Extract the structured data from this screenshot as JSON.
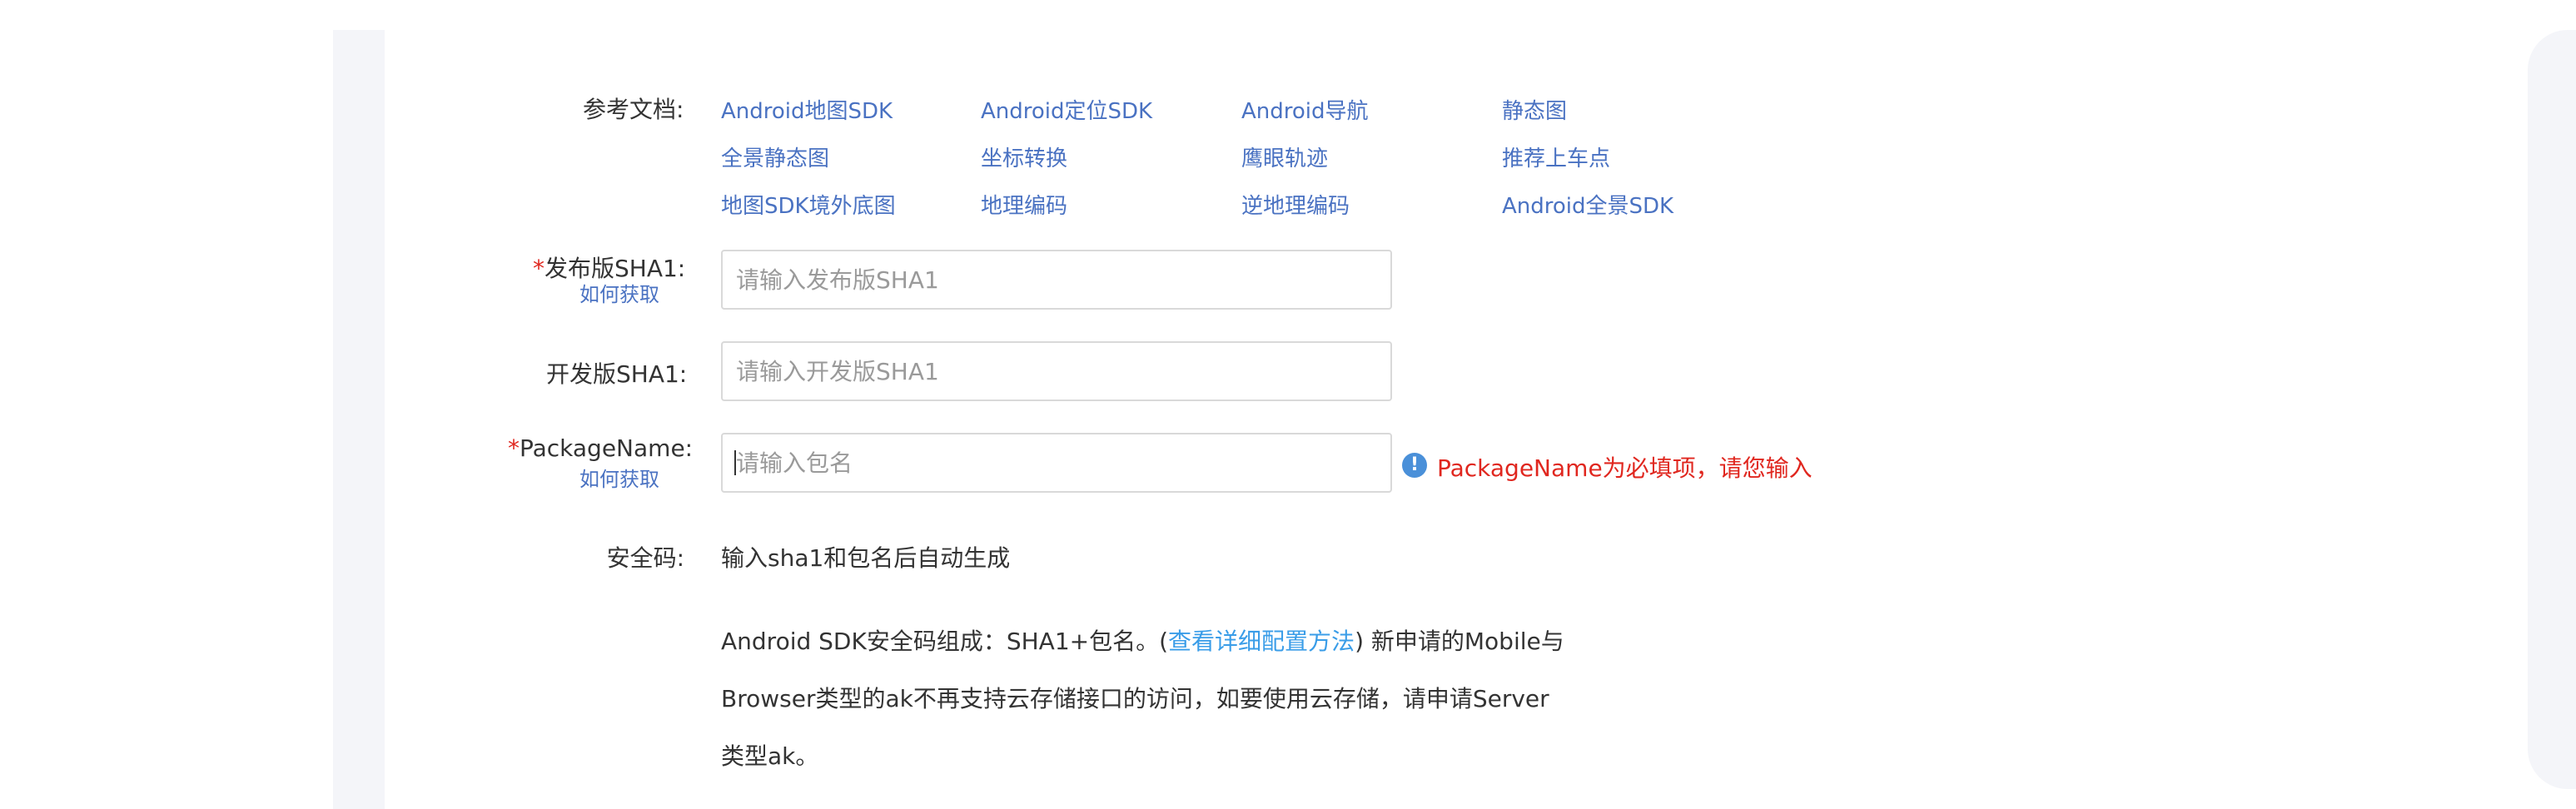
{
  "form": {
    "docs": {
      "label": "参考文档:",
      "links": [
        [
          "Android地图SDK",
          "Android定位SDK",
          "Android导航",
          "静态图"
        ],
        [
          "全景静态图",
          "坐标转换",
          "鹰眼轨迹",
          "推荐上车点"
        ],
        [
          "地图SDK境外底图",
          "地理编码",
          "逆地理编码",
          "Android全景SDK"
        ]
      ]
    },
    "release_sha1": {
      "required_mark": "*",
      "label": "发布版SHA1:",
      "help_link": "如何获取",
      "placeholder": "请输入发布版SHA1"
    },
    "dev_sha1": {
      "label": "开发版SHA1:",
      "placeholder": "请输入开发版SHA1"
    },
    "package_name": {
      "required_mark": "*",
      "label": "PackageName:",
      "help_link": "如何获取",
      "placeholder": "请输入包名",
      "error_icon": "!",
      "error": "PackageName为必填项，请您输入"
    },
    "security_code": {
      "label": "安全码:",
      "value": "输入sha1和包名后自动生成"
    },
    "note": {
      "line1_prefix": "Android SDK安全码组成：SHA1+包名。(",
      "line1_link": "查看详细配置方法",
      "line1_suffix": ") 新申请的Mobile与",
      "line2": "Browser类型的ak不再支持云存储接口的访问，如要使用云存储，请申请Server",
      "line3": "类型ak。"
    }
  },
  "colors": {
    "link": "#4a72c2",
    "inline_link": "#3a9de8",
    "error": "#e0271f",
    "error_icon_bg": "#4a90d9",
    "side_strip": "#f4f5f9"
  }
}
